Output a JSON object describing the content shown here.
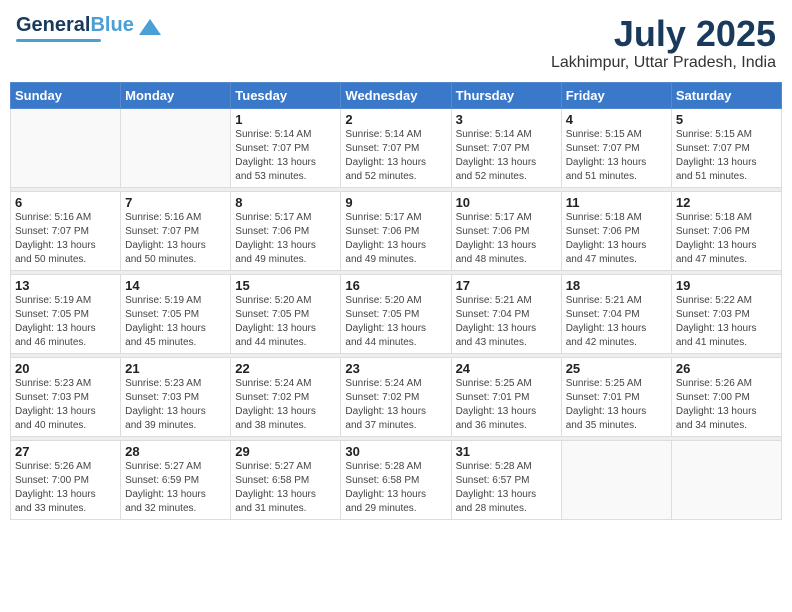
{
  "header": {
    "logo_general": "General",
    "logo_blue": "Blue",
    "month_title": "July 2025",
    "location": "Lakhimpur, Uttar Pradesh, India"
  },
  "weekdays": [
    "Sunday",
    "Monday",
    "Tuesday",
    "Wednesday",
    "Thursday",
    "Friday",
    "Saturday"
  ],
  "weeks": [
    [
      {
        "day": "",
        "info": ""
      },
      {
        "day": "",
        "info": ""
      },
      {
        "day": "1",
        "info": "Sunrise: 5:14 AM\nSunset: 7:07 PM\nDaylight: 13 hours\nand 53 minutes."
      },
      {
        "day": "2",
        "info": "Sunrise: 5:14 AM\nSunset: 7:07 PM\nDaylight: 13 hours\nand 52 minutes."
      },
      {
        "day": "3",
        "info": "Sunrise: 5:14 AM\nSunset: 7:07 PM\nDaylight: 13 hours\nand 52 minutes."
      },
      {
        "day": "4",
        "info": "Sunrise: 5:15 AM\nSunset: 7:07 PM\nDaylight: 13 hours\nand 51 minutes."
      },
      {
        "day": "5",
        "info": "Sunrise: 5:15 AM\nSunset: 7:07 PM\nDaylight: 13 hours\nand 51 minutes."
      }
    ],
    [
      {
        "day": "6",
        "info": "Sunrise: 5:16 AM\nSunset: 7:07 PM\nDaylight: 13 hours\nand 50 minutes."
      },
      {
        "day": "7",
        "info": "Sunrise: 5:16 AM\nSunset: 7:07 PM\nDaylight: 13 hours\nand 50 minutes."
      },
      {
        "day": "8",
        "info": "Sunrise: 5:17 AM\nSunset: 7:06 PM\nDaylight: 13 hours\nand 49 minutes."
      },
      {
        "day": "9",
        "info": "Sunrise: 5:17 AM\nSunset: 7:06 PM\nDaylight: 13 hours\nand 49 minutes."
      },
      {
        "day": "10",
        "info": "Sunrise: 5:17 AM\nSunset: 7:06 PM\nDaylight: 13 hours\nand 48 minutes."
      },
      {
        "day": "11",
        "info": "Sunrise: 5:18 AM\nSunset: 7:06 PM\nDaylight: 13 hours\nand 47 minutes."
      },
      {
        "day": "12",
        "info": "Sunrise: 5:18 AM\nSunset: 7:06 PM\nDaylight: 13 hours\nand 47 minutes."
      }
    ],
    [
      {
        "day": "13",
        "info": "Sunrise: 5:19 AM\nSunset: 7:05 PM\nDaylight: 13 hours\nand 46 minutes."
      },
      {
        "day": "14",
        "info": "Sunrise: 5:19 AM\nSunset: 7:05 PM\nDaylight: 13 hours\nand 45 minutes."
      },
      {
        "day": "15",
        "info": "Sunrise: 5:20 AM\nSunset: 7:05 PM\nDaylight: 13 hours\nand 44 minutes."
      },
      {
        "day": "16",
        "info": "Sunrise: 5:20 AM\nSunset: 7:05 PM\nDaylight: 13 hours\nand 44 minutes."
      },
      {
        "day": "17",
        "info": "Sunrise: 5:21 AM\nSunset: 7:04 PM\nDaylight: 13 hours\nand 43 minutes."
      },
      {
        "day": "18",
        "info": "Sunrise: 5:21 AM\nSunset: 7:04 PM\nDaylight: 13 hours\nand 42 minutes."
      },
      {
        "day": "19",
        "info": "Sunrise: 5:22 AM\nSunset: 7:03 PM\nDaylight: 13 hours\nand 41 minutes."
      }
    ],
    [
      {
        "day": "20",
        "info": "Sunrise: 5:23 AM\nSunset: 7:03 PM\nDaylight: 13 hours\nand 40 minutes."
      },
      {
        "day": "21",
        "info": "Sunrise: 5:23 AM\nSunset: 7:03 PM\nDaylight: 13 hours\nand 39 minutes."
      },
      {
        "day": "22",
        "info": "Sunrise: 5:24 AM\nSunset: 7:02 PM\nDaylight: 13 hours\nand 38 minutes."
      },
      {
        "day": "23",
        "info": "Sunrise: 5:24 AM\nSunset: 7:02 PM\nDaylight: 13 hours\nand 37 minutes."
      },
      {
        "day": "24",
        "info": "Sunrise: 5:25 AM\nSunset: 7:01 PM\nDaylight: 13 hours\nand 36 minutes."
      },
      {
        "day": "25",
        "info": "Sunrise: 5:25 AM\nSunset: 7:01 PM\nDaylight: 13 hours\nand 35 minutes."
      },
      {
        "day": "26",
        "info": "Sunrise: 5:26 AM\nSunset: 7:00 PM\nDaylight: 13 hours\nand 34 minutes."
      }
    ],
    [
      {
        "day": "27",
        "info": "Sunrise: 5:26 AM\nSunset: 7:00 PM\nDaylight: 13 hours\nand 33 minutes."
      },
      {
        "day": "28",
        "info": "Sunrise: 5:27 AM\nSunset: 6:59 PM\nDaylight: 13 hours\nand 32 minutes."
      },
      {
        "day": "29",
        "info": "Sunrise: 5:27 AM\nSunset: 6:58 PM\nDaylight: 13 hours\nand 31 minutes."
      },
      {
        "day": "30",
        "info": "Sunrise: 5:28 AM\nSunset: 6:58 PM\nDaylight: 13 hours\nand 29 minutes."
      },
      {
        "day": "31",
        "info": "Sunrise: 5:28 AM\nSunset: 6:57 PM\nDaylight: 13 hours\nand 28 minutes."
      },
      {
        "day": "",
        "info": ""
      },
      {
        "day": "",
        "info": ""
      }
    ]
  ]
}
